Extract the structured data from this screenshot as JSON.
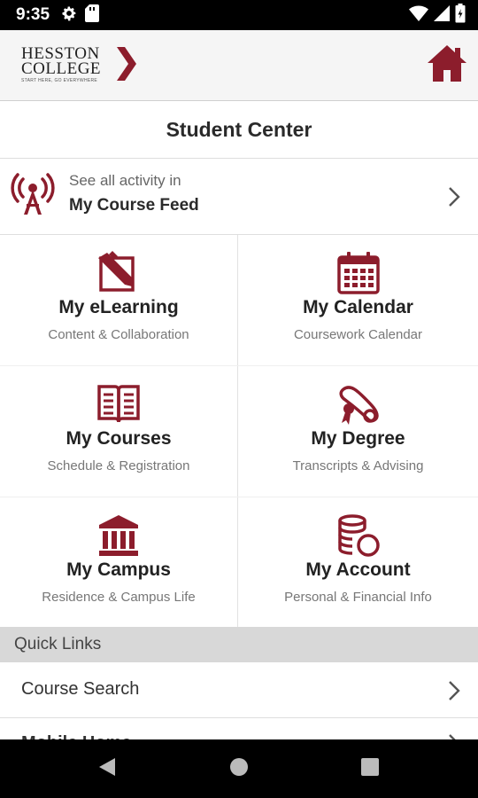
{
  "status_bar": {
    "time": "9:35"
  },
  "header": {
    "logo_line1": "HESSTON",
    "logo_line2": "COLLEGE",
    "logo_tagline": "START HERE, GO EVERYWHERE"
  },
  "page": {
    "title": "Student Center"
  },
  "feed": {
    "subtitle": "See all activity in",
    "title": "My Course Feed"
  },
  "tiles": [
    {
      "title": "My eLearning",
      "subtitle": "Content & Collaboration",
      "icon": "elearning-pencil-icon"
    },
    {
      "title": "My Calendar",
      "subtitle": "Coursework Calendar",
      "icon": "calendar-icon"
    },
    {
      "title": "My Courses",
      "subtitle": "Schedule & Registration",
      "icon": "book-icon"
    },
    {
      "title": "My Degree",
      "subtitle": "Transcripts & Advising",
      "icon": "diploma-icon"
    },
    {
      "title": "My Campus",
      "subtitle": "Residence & Campus Life",
      "icon": "building-icon"
    },
    {
      "title": "My Account",
      "subtitle": "Personal & Financial Info",
      "icon": "coins-icon"
    }
  ],
  "quick_links": {
    "header": "Quick Links",
    "items": [
      {
        "label": "Course Search"
      },
      {
        "label": "Mobile Home"
      }
    ]
  },
  "colors": {
    "accent": "#8c1d2c",
    "background": "#ffffff",
    "section_header": "#d8d8d8"
  }
}
